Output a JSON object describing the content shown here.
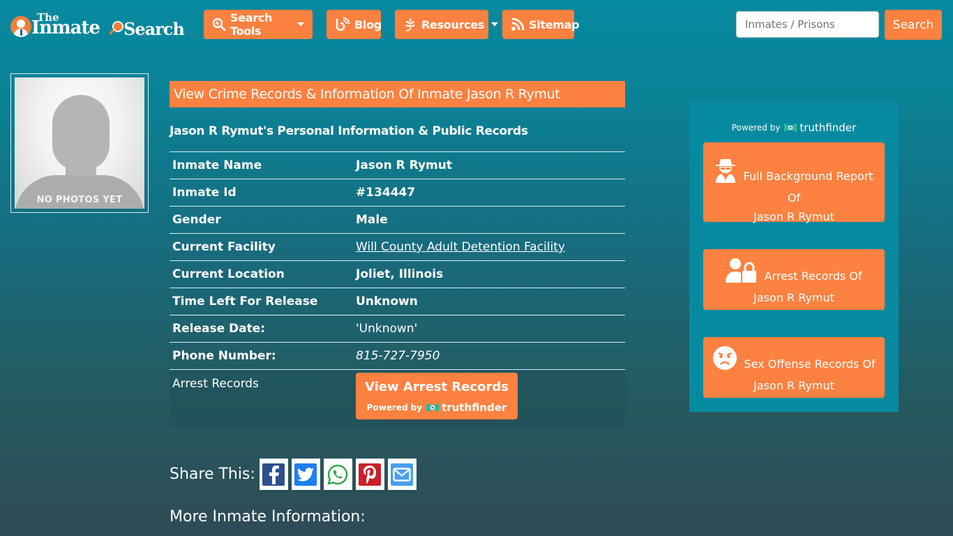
{
  "header": {
    "logo": {
      "the": "The",
      "inmate": "Inmate",
      "search": "Search"
    },
    "nav": [
      {
        "label": "Search Tools",
        "icon": "search-tools-icon",
        "dropdown": true
      },
      {
        "label": "Blog",
        "icon": "blog-icon",
        "dropdown": false
      },
      {
        "label": "Resources",
        "icon": "leaf-icon",
        "dropdown": true
      },
      {
        "label": "Sitemap",
        "icon": "rss-icon",
        "dropdown": false
      }
    ],
    "search": {
      "placeholder": "Inmates / Prisons",
      "value": "",
      "button_label": "Search"
    }
  },
  "photo": {
    "label": "NO PHOTOS YET"
  },
  "main": {
    "title": "View Crime Records & Information Of Inmate Jason R Rymut",
    "subtitle": "Jason R Rymut's Personal Information & Public Records",
    "rows": [
      {
        "key": "Inmate Name",
        "value": "Jason R Rymut"
      },
      {
        "key": "Inmate Id",
        "value": "#134447"
      },
      {
        "key": "Gender",
        "value": "Male"
      },
      {
        "key": "Current Facility",
        "value": "Will County Adult Detention Facility"
      },
      {
        "key": "Current Location",
        "value": "Joliet, Illinois"
      },
      {
        "key": "Time Left For Release",
        "value": "Unknown"
      },
      {
        "key": "Release Date:",
        "value": "'Unknown'"
      },
      {
        "key": "Phone Number:",
        "value": "815-727-7950"
      }
    ],
    "arrest_row": {
      "key": "Arrest Records",
      "button_label": "View Arrest Records",
      "powered_by": "Powered by",
      "brand": "truthfinder"
    },
    "share": {
      "label": "Share This:",
      "networks": [
        {
          "name": "facebook",
          "color": "#2d4f8e"
        },
        {
          "name": "twitter",
          "color": "#1d7ff0"
        },
        {
          "name": "whatsapp",
          "color": "#2aa746"
        },
        {
          "name": "pinterest",
          "color": "#cb2027"
        },
        {
          "name": "email",
          "color": "#4a9ff2"
        }
      ]
    },
    "more_info": "More Inmate Information:"
  },
  "sidebar": {
    "powered_by": "Powered by",
    "brand": "truthfinder",
    "buttons": [
      {
        "line1": "Full Background Report",
        "line2": "Of",
        "line3": "Jason R Rymut",
        "icon": "spy-icon"
      },
      {
        "line1": "Arrest Records Of",
        "line2": "Jason R Rymut",
        "icon": "user-lock-icon"
      },
      {
        "line1": "Sex Offense Records Of",
        "line2": "Jason R Rymut",
        "icon": "angry-face-icon"
      }
    ]
  },
  "colors": {
    "accent": "#fd8140",
    "header_bg": "#078aa0",
    "page_bottom": "#2f4b57",
    "text": "#ffffff"
  }
}
